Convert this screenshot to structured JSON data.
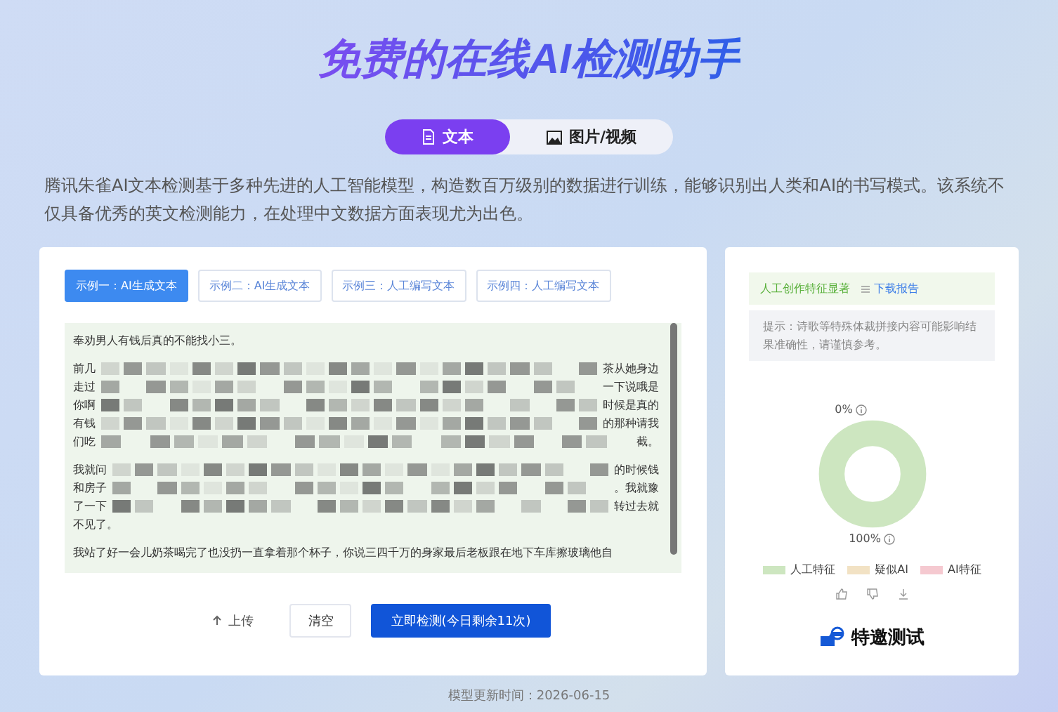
{
  "title": "免费的在线AI检测助手",
  "mode_tabs": [
    {
      "label": "文本",
      "selected": true
    },
    {
      "label": "图片/视频",
      "selected": false
    }
  ],
  "description": "腾讯朱雀AI文本检测基于多种先进的人工智能模型，构造数百万级别的数据进行训练，能够识别出人类和AI的书写模式。该系统不仅具备优秀的英文检测能力，在处理中文数据方面表现尤为出色。",
  "examples": [
    {
      "label": "示例一：AI生成文本",
      "selected": true
    },
    {
      "label": "示例二：AI生成文本",
      "selected": false
    },
    {
      "label": "示例三：人工编写文本",
      "selected": false
    },
    {
      "label": "示例四：人工编写文本",
      "selected": false
    }
  ],
  "editor": {
    "paragraphs": [
      [
        {
          "start": "奉劝男人有钱后真的不能找小三。"
        }
      ],
      [
        {
          "start": "前几",
          "end": "茶从她身边"
        },
        {
          "start": "走过",
          "end": "一下说哦是"
        },
        {
          "start": "你啊",
          "end": "时候是真的"
        },
        {
          "start": "有钱",
          "end": "的那种请我"
        },
        {
          "start": "们吃",
          "end": "截。"
        }
      ],
      [
        {
          "start": "我就问",
          "end": "的时候钱"
        },
        {
          "start": "和房子",
          "end": "。我就豫"
        },
        {
          "start": "了一下",
          "end": "转过去就"
        },
        {
          "start": "不见了。"
        }
      ],
      [
        {
          "start": "我站了好一会儿奶茶喝完了也没扔一直拿着那个杯子，你说三四千万的身家最后老板跟在地下车库擦玻璃他自"
        }
      ]
    ]
  },
  "actions": [
    {
      "label": "上传",
      "kind": "upload"
    },
    {
      "label": "清空",
      "kind": "outline"
    },
    {
      "label": "立即检测(今日剩余11次)",
      "kind": "primary"
    }
  ],
  "result": {
    "verdict": "人工创作特征显著",
    "download": "下载报告",
    "hint": "提示：诗歌等特殊体裁拼接内容可能影响结果准确性，请谨慎参考。",
    "top_label": "0%",
    "bottom_label": "100%",
    "legend": [
      {
        "label": "人工特征",
        "color": "#cde6c0"
      },
      {
        "label": "疑似AI",
        "color": "#f2e2c4"
      },
      {
        "label": "AI特征",
        "color": "#f5c9d0"
      }
    ],
    "badge": "特邀测试"
  },
  "footer": "模型更新时间：2026-06-15"
}
